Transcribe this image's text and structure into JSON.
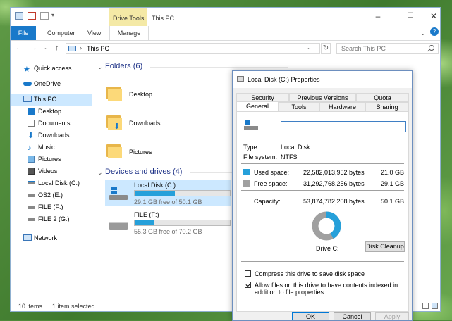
{
  "window": {
    "title": "This PC",
    "context_tab_group": "Drive Tools",
    "ribbon_tabs": [
      "File",
      "Computer",
      "View",
      "Manage"
    ],
    "address": "This PC",
    "search_placeholder": "Search This PC"
  },
  "nav_pane": {
    "items": [
      {
        "label": "Quick access",
        "icon": "star-icon"
      },
      {
        "label": "OneDrive",
        "icon": "cloud-icon"
      },
      {
        "label": "This PC",
        "icon": "computer-icon"
      },
      {
        "label": "Desktop",
        "icon": "desktop-icon"
      },
      {
        "label": "Documents",
        "icon": "documents-icon"
      },
      {
        "label": "Downloads",
        "icon": "download-icon"
      },
      {
        "label": "Music",
        "icon": "music-icon"
      },
      {
        "label": "Pictures",
        "icon": "pictures-icon"
      },
      {
        "label": "Videos",
        "icon": "videos-icon"
      },
      {
        "label": "Local Disk (C:)",
        "icon": "drive-icon"
      },
      {
        "label": "OS2 (E:)",
        "icon": "drive-icon"
      },
      {
        "label": "FILE (F:)",
        "icon": "drive-icon"
      },
      {
        "label": "FILE 2 (G:)",
        "icon": "drive-icon"
      },
      {
        "label": "Network",
        "icon": "network-icon"
      }
    ]
  },
  "content": {
    "folders_header": "Folders (6)",
    "folders": [
      "Desktop",
      "Downloads",
      "Pictures"
    ],
    "drives_header": "Devices and drives (4)",
    "drives": [
      {
        "name": "Local Disk (C:)",
        "free_text": "29.1 GB free of 50.1 GB",
        "used_fraction": 0.42
      },
      {
        "name": "FILE (F:)",
        "free_text": "55.3 GB free of 70.2 GB",
        "used_fraction": 0.21
      }
    ]
  },
  "status_bar": {
    "item_count": "10 items",
    "selection": "1 item selected"
  },
  "dialog": {
    "title": "Local Disk (C:) Properties",
    "tabs_row1": [
      "Security",
      "Previous Versions",
      "Quota"
    ],
    "tabs_row2": [
      "General",
      "Tools",
      "Hardware",
      "Sharing"
    ],
    "active_tab": "General",
    "name_value": "",
    "type_label": "Type:",
    "type_value": "Local Disk",
    "fs_label": "File system:",
    "fs_value": "NTFS",
    "used_label": "Used space:",
    "used_bytes": "22,582,013,952 bytes",
    "used_gb": "21.0 GB",
    "free_label": "Free space:",
    "free_bytes": "31,292,768,256 bytes",
    "free_gb": "29.1 GB",
    "capacity_label": "Capacity:",
    "capacity_bytes": "53,874,782,208 bytes",
    "capacity_gb": "50.1 GB",
    "used_fraction": 0.419,
    "drive_label": "Drive C:",
    "cleanup_button": "Disk Cleanup",
    "compress_label": "Compress this drive to save disk space",
    "compress_checked": false,
    "index_label": "Allow files on this drive to have contents indexed in addition to file properties",
    "index_checked": true,
    "ok": "OK",
    "cancel": "Cancel",
    "apply": "Apply",
    "colors": {
      "used": "#26a0da",
      "free": "#a0a0a0"
    }
  }
}
